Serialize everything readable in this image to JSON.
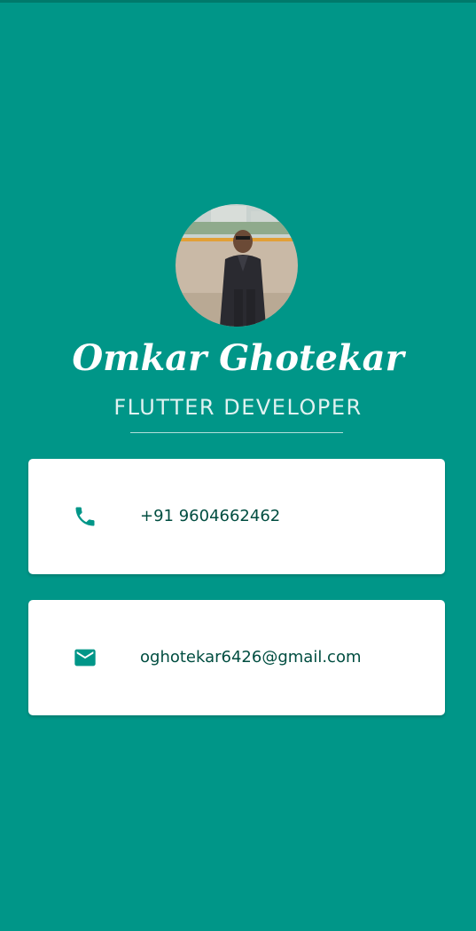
{
  "profile": {
    "name": "Omkar Ghotekar",
    "title": "FLUTTER DEVELOPER"
  },
  "contacts": [
    {
      "icon": "phone-icon",
      "value": "+91 9604662462"
    },
    {
      "icon": "mail-icon",
      "value": "oghotekar6426@gmail.com"
    }
  ],
  "colors": {
    "background": "#009688",
    "card": "#ffffff",
    "icon": "#009688",
    "text": "#004d40"
  }
}
